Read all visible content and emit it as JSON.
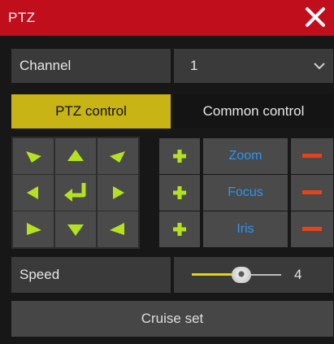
{
  "window": {
    "title": "PTZ"
  },
  "channel": {
    "label": "Channel",
    "value": "1"
  },
  "tabs": [
    {
      "label": "PTZ control",
      "active": true
    },
    {
      "label": "Common control",
      "active": false
    }
  ],
  "dpad": {
    "buttons": [
      "up-left",
      "up",
      "up-right",
      "left",
      "home",
      "right",
      "down-left",
      "down",
      "down-right"
    ],
    "arrow_color": "#b5e21e"
  },
  "lens": {
    "items": [
      {
        "label": "Zoom"
      },
      {
        "label": "Focus"
      },
      {
        "label": "Iris"
      }
    ],
    "plus_color": "#b5e21e",
    "minus_color": "#e8421a",
    "label_color": "#2c95f2"
  },
  "speed": {
    "label": "Speed",
    "value": "4",
    "level_fraction": 0.55
  },
  "cruise": {
    "label": "Cruise set"
  },
  "colors": {
    "title_bar": "#c10e1d",
    "active_tab": "#c8b414",
    "slider_fill": "#e4d20a"
  }
}
